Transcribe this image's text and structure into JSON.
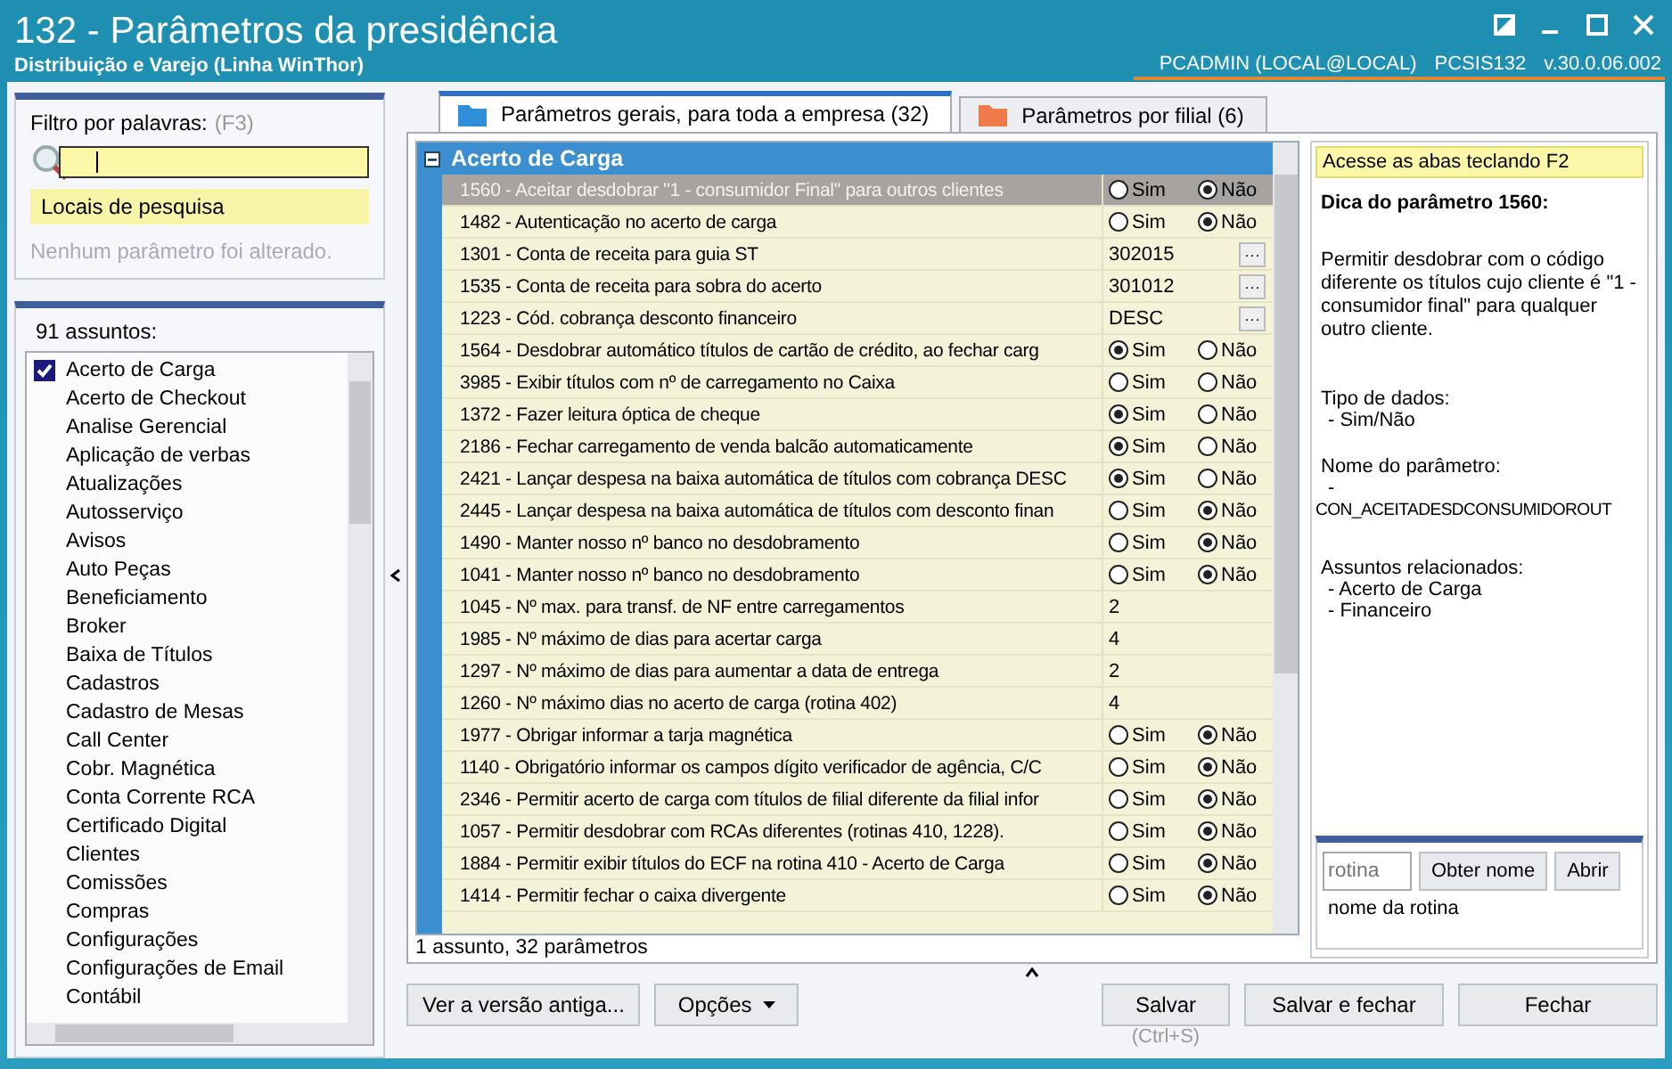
{
  "window": {
    "title": "132 - Parâmetros da presidência",
    "subtitle": "Distribuição e Varejo (Linha WinThor)",
    "user": "PCADMIN (LOCAL@LOCAL)",
    "routine": "PCSIS132",
    "version": "v.30.0.06.002"
  },
  "filter": {
    "label": "Filtro por palavras:",
    "shortcut": "(F3)",
    "search_locations": "Locais de pesquisa",
    "note": "Nenhum parâmetro foi alterado."
  },
  "subjects": {
    "count_label": "91 assuntos:",
    "items": [
      {
        "label": "Acerto de Carga",
        "checked": true
      },
      {
        "label": "Acerto de Checkout",
        "checked": false
      },
      {
        "label": "Analise Gerencial",
        "checked": false
      },
      {
        "label": "Aplicação de verbas",
        "checked": false
      },
      {
        "label": "Atualizações",
        "checked": false
      },
      {
        "label": "Autosserviço",
        "checked": false
      },
      {
        "label": "Avisos",
        "checked": false
      },
      {
        "label": "Auto Peças",
        "checked": false
      },
      {
        "label": "Beneficiamento",
        "checked": false
      },
      {
        "label": "Broker",
        "checked": false
      },
      {
        "label": "Baixa de Títulos",
        "checked": false
      },
      {
        "label": "Cadastros",
        "checked": false
      },
      {
        "label": "Cadastro de Mesas",
        "checked": false
      },
      {
        "label": "Call Center",
        "checked": false
      },
      {
        "label": "Cobr. Magnética",
        "checked": false
      },
      {
        "label": "Conta Corrente RCA",
        "checked": false
      },
      {
        "label": "Certificado Digital",
        "checked": false
      },
      {
        "label": "Clientes",
        "checked": false
      },
      {
        "label": "Comissões",
        "checked": false
      },
      {
        "label": "Compras",
        "checked": false
      },
      {
        "label": "Configurações",
        "checked": false
      },
      {
        "label": "Configurações de Email",
        "checked": false
      },
      {
        "label": "Contábil",
        "checked": false
      }
    ]
  },
  "tabs": [
    {
      "label": "Parâmetros gerais, para toda a empresa  (32)",
      "selected": true,
      "color": "#2f8fd8"
    },
    {
      "label": "Parâmetros por filial  (6)",
      "selected": false,
      "color": "#f07a4a"
    }
  ],
  "grid": {
    "group": "Acerto de Carga",
    "rows": [
      {
        "label": "1560 - Aceitar desdobrar \"1 - consumidor Final\" para outros clientes",
        "selected": true,
        "kind": "bool",
        "options": [
          {
            "label": "Sim",
            "selected": false
          },
          {
            "label": "Não",
            "selected": true
          }
        ]
      },
      {
        "label": "1482 - Autenticação no acerto de carga",
        "selected": false,
        "kind": "bool",
        "options": [
          {
            "label": "Sim",
            "selected": false
          },
          {
            "label": "Não",
            "selected": true
          }
        ]
      },
      {
        "label": "1301 - Conta de receita para guia ST",
        "selected": false,
        "kind": "lookup",
        "value": "302015",
        "button": "···"
      },
      {
        "label": "1535 - Conta de receita para sobra do acerto",
        "selected": false,
        "kind": "lookup",
        "value": "301012",
        "button": "···"
      },
      {
        "label": "1223 - Cód. cobrança desconto financeiro",
        "selected": false,
        "kind": "lookup",
        "value": "DESC",
        "button": "···"
      },
      {
        "label": "1564 - Desdobrar automático títulos de cartão de crédito, ao fechar carg",
        "selected": false,
        "kind": "bool",
        "options": [
          {
            "label": "Sim",
            "selected": true
          },
          {
            "label": "Não",
            "selected": false
          }
        ]
      },
      {
        "label": "3985 - Exibir títulos com nº de carregamento no Caixa",
        "selected": false,
        "kind": "bool",
        "options": [
          {
            "label": "Sim",
            "selected": false
          },
          {
            "label": "Não",
            "selected": false
          }
        ]
      },
      {
        "label": "1372 - Fazer leitura óptica de cheque",
        "selected": false,
        "kind": "bool",
        "options": [
          {
            "label": "Sim",
            "selected": true
          },
          {
            "label": "Não",
            "selected": false
          }
        ]
      },
      {
        "label": "2186 - Fechar carregamento de venda balcão automaticamente",
        "selected": false,
        "kind": "bool",
        "options": [
          {
            "label": "Sim",
            "selected": true
          },
          {
            "label": "Não",
            "selected": false
          }
        ]
      },
      {
        "label": "2421 - Lançar despesa na baixa automática de títulos com cobrança DESC",
        "selected": false,
        "kind": "bool",
        "options": [
          {
            "label": "Sim",
            "selected": true
          },
          {
            "label": "Não",
            "selected": false
          }
        ]
      },
      {
        "label": "2445 - Lançar despesa na baixa automática de títulos com desconto finan",
        "selected": false,
        "kind": "bool",
        "options": [
          {
            "label": "Sim",
            "selected": false
          },
          {
            "label": "Não",
            "selected": true
          }
        ]
      },
      {
        "label": "1490 - Manter nosso nº banco no desdobramento",
        "selected": false,
        "kind": "bool",
        "options": [
          {
            "label": "Sim",
            "selected": false
          },
          {
            "label": "Não",
            "selected": true
          }
        ]
      },
      {
        "label": "1041 - Manter nosso nº banco no desdobramento",
        "selected": false,
        "kind": "bool",
        "options": [
          {
            "label": "Sim",
            "selected": false
          },
          {
            "label": "Não",
            "selected": true
          }
        ]
      },
      {
        "label": "1045 - Nº max. para transf. de NF entre carregamentos",
        "selected": false,
        "kind": "value",
        "value": "2"
      },
      {
        "label": "1985 - Nº máximo de dias para acertar carga",
        "selected": false,
        "kind": "value",
        "value": "4"
      },
      {
        "label": "1297 - Nº máximo de dias para aumentar a data de entrega",
        "selected": false,
        "kind": "value",
        "value": "2"
      },
      {
        "label": "1260 - Nº máximo dias no acerto de carga (rotina 402)",
        "selected": false,
        "kind": "value",
        "value": "4"
      },
      {
        "label": "1977 - Obrigar informar a tarja magnética",
        "selected": false,
        "kind": "bool",
        "options": [
          {
            "label": "Sim",
            "selected": false
          },
          {
            "label": "Não",
            "selected": true
          }
        ]
      },
      {
        "label": "1140 - Obrigatório informar os campos dígito verificador de agência, C/C",
        "selected": false,
        "kind": "bool",
        "options": [
          {
            "label": "Sim",
            "selected": false
          },
          {
            "label": "Não",
            "selected": true
          }
        ]
      },
      {
        "label": "2346 - Permitir acerto de carga com títulos de filial diferente da filial infor",
        "selected": false,
        "kind": "bool",
        "options": [
          {
            "label": "Sim",
            "selected": false
          },
          {
            "label": "Não",
            "selected": true
          }
        ]
      },
      {
        "label": "1057 - Permitir desdobrar com RCAs diferentes (rotinas 410, 1228).",
        "selected": false,
        "kind": "bool",
        "options": [
          {
            "label": "Sim",
            "selected": false
          },
          {
            "label": "Não",
            "selected": true
          }
        ]
      },
      {
        "label": "1884 - Permitir exibir títulos do ECF na rotina 410 - Acerto de Carga",
        "selected": false,
        "kind": "bool",
        "options": [
          {
            "label": "Sim",
            "selected": false
          },
          {
            "label": "Não",
            "selected": true
          }
        ]
      },
      {
        "label": "1414 - Permitir fechar o caixa divergente",
        "selected": false,
        "kind": "bool",
        "options": [
          {
            "label": "Sim",
            "selected": false
          },
          {
            "label": "Não",
            "selected": true
          }
        ]
      }
    ],
    "status": "1 assunto, 32 parâmetros"
  },
  "tip": {
    "hint": "Acesse as abas teclando F2",
    "title": "Dica do parâmetro 1560:",
    "description": "Permitir desdobrar com o código diferente os títulos cujo cliente é \"1 - consumidor final\" para qualquer outro cliente.",
    "data_type_label": "Tipo de dados:",
    "data_type": "- Sim/Não",
    "name_label": "Nome do parâmetro:",
    "name_dash": "-",
    "name": "CON_ACEITADESDCONSUMIDOROUT",
    "related_label": "Assuntos relacionados:",
    "related": [
      "- Acerto de Carga",
      "- Financeiro"
    ],
    "routine_placeholder": "rotina",
    "get_name_button": "Obter nome",
    "open_button": "Abrir",
    "routine_name": "nome da rotina"
  },
  "buttons": {
    "old_version": "Ver a versão antiga...",
    "options": "Opções",
    "save": "Salvar",
    "save_shortcut": "(Ctrl+S)",
    "save_close": "Salvar e fechar",
    "close": "Fechar"
  }
}
